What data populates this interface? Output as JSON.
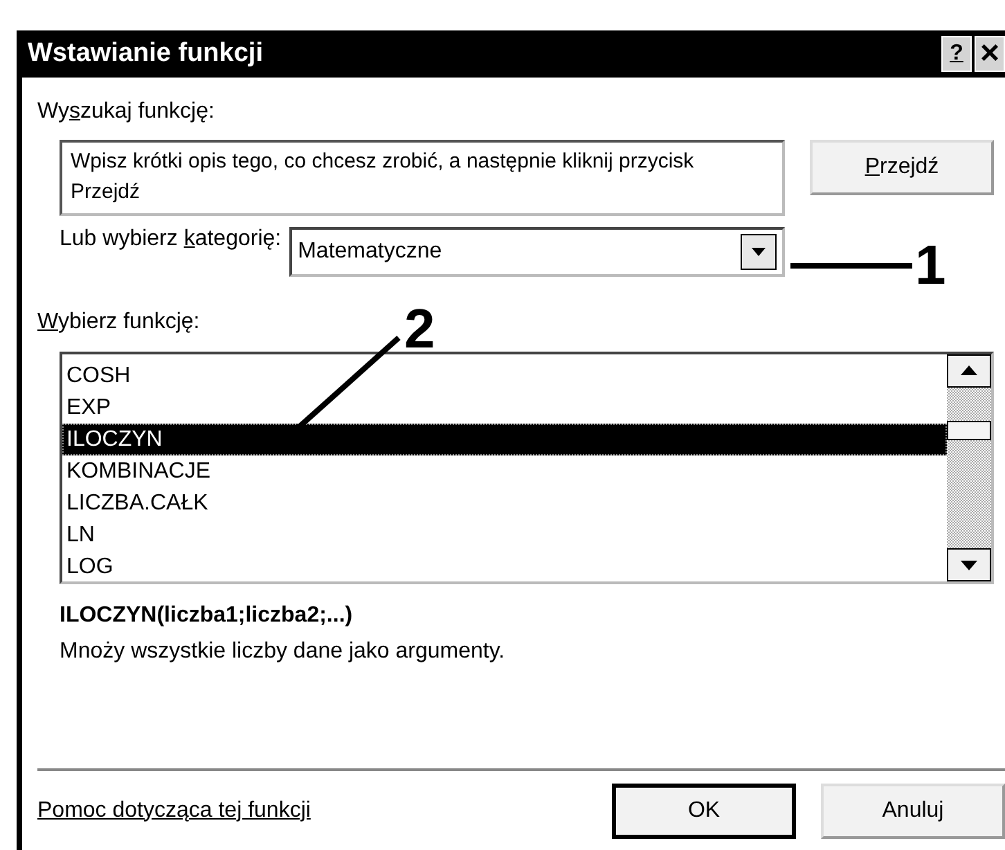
{
  "window": {
    "title": "Wstawianie funkcji",
    "buttons": [
      {
        "kind": "help",
        "label": "?"
      },
      {
        "kind": "close",
        "label": "×"
      }
    ]
  },
  "search": {
    "label": {
      "before": "Wy",
      "key": "s",
      "after": "zukaj funkcję:"
    },
    "value": "Wpisz krótki opis tego, co chcesz zrobić, a następnie kliknij przycisk Przejdź",
    "button": {
      "key": "P",
      "after": "rzejdź"
    }
  },
  "category": {
    "label": {
      "before": "Lub wybierz ",
      "key": "k",
      "after": "ategorię:"
    },
    "value": "Matematyczne"
  },
  "functions": {
    "label": {
      "key": "W",
      "after": "ybierz funkcję:"
    },
    "items": [
      {
        "label": "COSH",
        "selected": false
      },
      {
        "label": "EXP",
        "selected": false
      },
      {
        "label": "ILOCZYN",
        "selected": true
      },
      {
        "label": "KOMBINACJE",
        "selected": false
      },
      {
        "label": "LICZBA.CAŁK",
        "selected": false
      },
      {
        "label": "LN",
        "selected": false
      },
      {
        "label": "LOG",
        "selected": false
      }
    ]
  },
  "description": {
    "signature": "ILOCZYN(liczba1;liczba2;...)",
    "text": "Mnoży wszystkie liczby dane jako argumenty."
  },
  "help_link": "Pomoc dotycząca tej funkcji",
  "buttons": [
    {
      "label": "OK",
      "default": true
    },
    {
      "label": "Anuluj",
      "default": false
    }
  ],
  "callouts": [
    {
      "label": "1"
    },
    {
      "label": "2"
    }
  ]
}
